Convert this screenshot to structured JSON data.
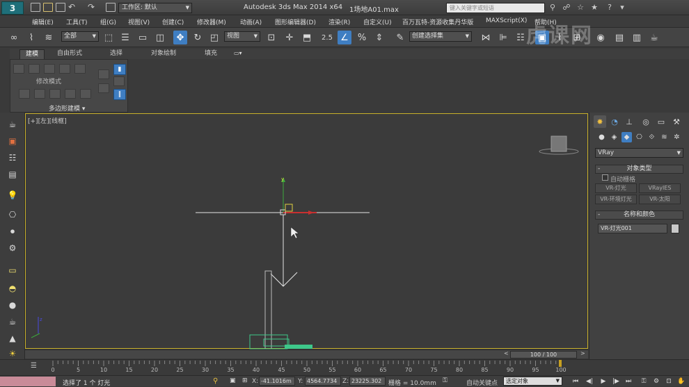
{
  "titlebar": {
    "logo": "3",
    "workspace": "工作区: 默认",
    "app_title": "Autodesk 3ds Max  2014 x64",
    "file_name": "1场地A01.max",
    "search_placeholder": "键入关键字或短语"
  },
  "menu": [
    "编辑(E)",
    "工具(T)",
    "组(G)",
    "视图(V)",
    "创建(C)",
    "修改器(M)",
    "动画(A)",
    "图形编辑器(D)",
    "渲染(R)",
    "自定义(U)",
    "百万瓦特-资源收集丹华版",
    "MAXScript(X)",
    "帮助(H)"
  ],
  "toolbar": {
    "filter": "全部",
    "ref_coord": "视图",
    "snap_value": "2.5",
    "named_selection": "创建选择集"
  },
  "ribbon": {
    "tabs": [
      "建模",
      "自由形式",
      "选择",
      "对象绘制",
      "填充"
    ],
    "modify_mode": "修改模式",
    "poly_modeling": "多边形建模"
  },
  "viewport": {
    "label": "[+][左][线框]"
  },
  "command_panel": {
    "renderer": "VRay",
    "object_type": {
      "header": "对象类型",
      "autogrid": "自动栅格",
      "buttons": [
        "VR-灯光",
        "VRayIES",
        "VR-环境灯光",
        "VR-太阳"
      ]
    },
    "name_color": {
      "header": "名称和颜色",
      "name": "VR-灯光001",
      "color": "#c8c8c8"
    }
  },
  "timeline": {
    "position": "100 / 100",
    "ticks": [
      "0",
      "5",
      "10",
      "15",
      "20",
      "25",
      "30",
      "35",
      "40",
      "45",
      "50",
      "55",
      "60",
      "65",
      "70",
      "75",
      "80",
      "85",
      "90",
      "95",
      "100"
    ]
  },
  "status": {
    "message": "选择了 1 个 灯光",
    "x_label": "X:",
    "x": "-41.1016m",
    "y_label": "Y:",
    "y": "4564.7734",
    "z_label": "Z:",
    "z": "23225.302",
    "grid": "栅格 = 10.0mm",
    "autokey": "自动关键点",
    "selection": "选定对象"
  },
  "watermark": "虎课网"
}
